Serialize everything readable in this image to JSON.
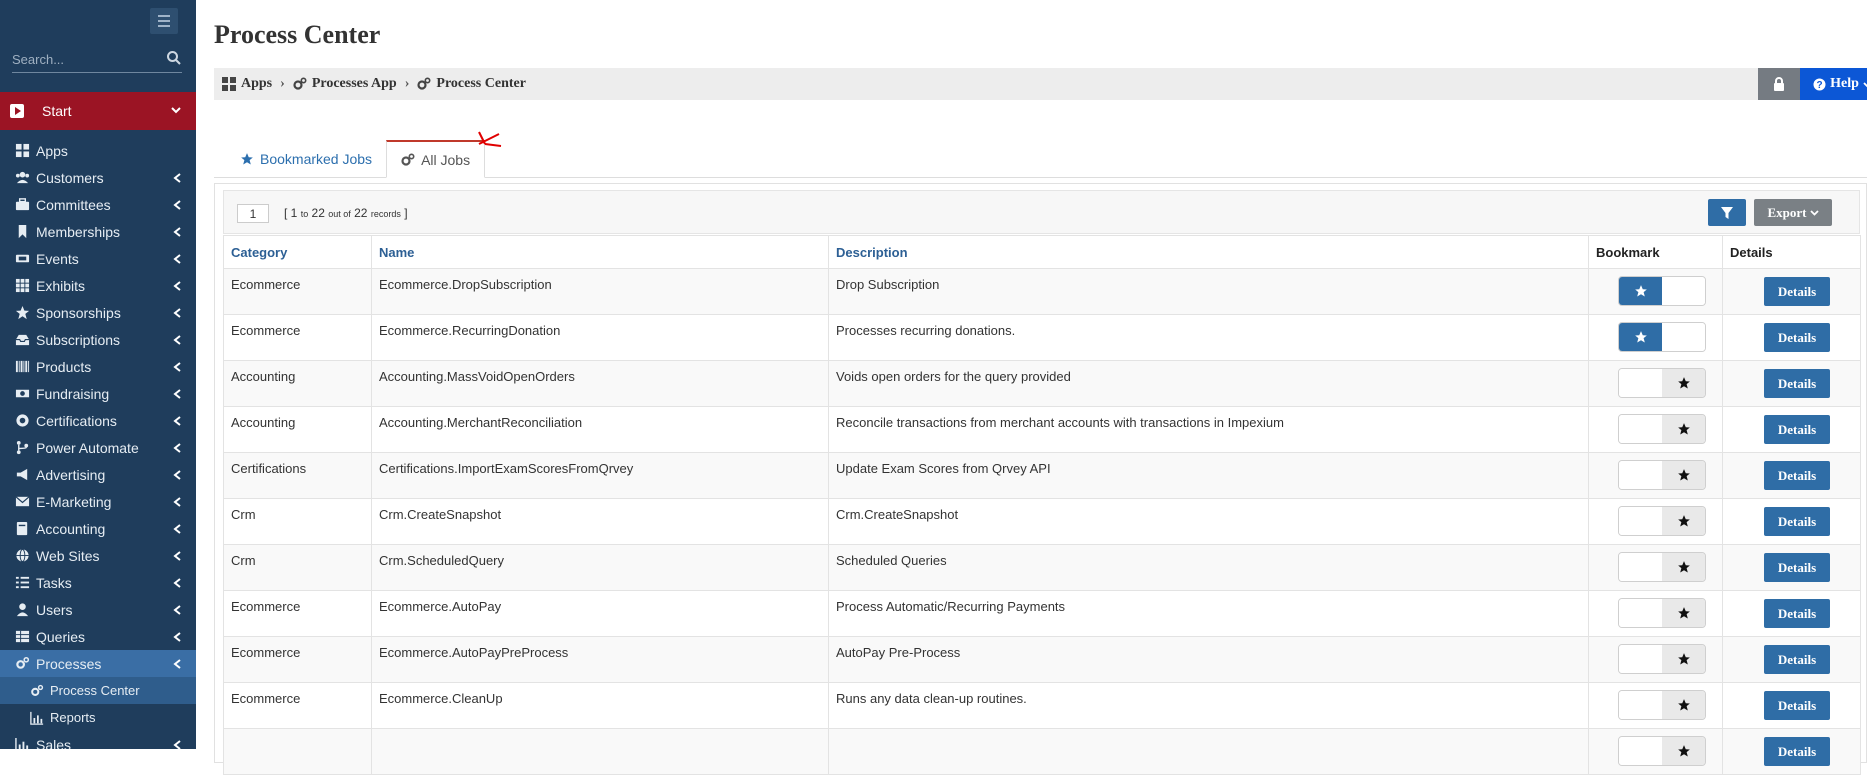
{
  "sidebar": {
    "search_placeholder": "Search...",
    "start_label": "Start",
    "items": [
      {
        "label": "Apps",
        "icon": "apps-icon",
        "has_chevron": false
      },
      {
        "label": "Customers",
        "icon": "users-icon",
        "has_chevron": true
      },
      {
        "label": "Committees",
        "icon": "briefcase-icon",
        "has_chevron": true
      },
      {
        "label": "Memberships",
        "icon": "bookmark-icon",
        "has_chevron": true
      },
      {
        "label": "Events",
        "icon": "ticket-icon",
        "has_chevron": true
      },
      {
        "label": "Exhibits",
        "icon": "grid-icon",
        "has_chevron": true
      },
      {
        "label": "Sponsorships",
        "icon": "star-icon",
        "has_chevron": true
      },
      {
        "label": "Subscriptions",
        "icon": "inbox-icon",
        "has_chevron": true
      },
      {
        "label": "Products",
        "icon": "barcode-icon",
        "has_chevron": true
      },
      {
        "label": "Fundraising",
        "icon": "money-icon",
        "has_chevron": true
      },
      {
        "label": "Certifications",
        "icon": "certificate-icon",
        "has_chevron": true
      },
      {
        "label": "Power Automate",
        "icon": "flow-icon",
        "has_chevron": true
      },
      {
        "label": "Advertising",
        "icon": "bullhorn-icon",
        "has_chevron": true
      },
      {
        "label": "E-Marketing",
        "icon": "envelope-icon",
        "has_chevron": true
      },
      {
        "label": "Accounting",
        "icon": "book-icon",
        "has_chevron": true
      },
      {
        "label": "Web Sites",
        "icon": "globe-icon",
        "has_chevron": true
      },
      {
        "label": "Tasks",
        "icon": "tasks-icon",
        "has_chevron": true
      },
      {
        "label": "Users",
        "icon": "user-icon",
        "has_chevron": true
      },
      {
        "label": "Queries",
        "icon": "table-icon",
        "has_chevron": true
      },
      {
        "label": "Processes",
        "icon": "cogs-icon",
        "has_chevron": true
      }
    ],
    "subitems": [
      {
        "label": "Process Center",
        "icon": "cogs-icon"
      },
      {
        "label": "Reports",
        "icon": "chart-icon"
      }
    ],
    "last_item": {
      "label": "Sales",
      "icon": "chart-icon"
    }
  },
  "page": {
    "title": "Process Center",
    "breadcrumbs": [
      "Apps",
      "Processes App",
      "Process Center"
    ],
    "help_label": "Help",
    "tabs": [
      {
        "label": "Bookmarked Jobs",
        "icon": "star-icon",
        "active": false
      },
      {
        "label": "All Jobs",
        "icon": "cogs-icon",
        "active": true
      }
    ]
  },
  "toolbar": {
    "page": "1",
    "records_open": "[ 1",
    "records_to": "to",
    "records_mid": "22",
    "records_outof": "out of",
    "records_total": "22",
    "records_word": "records",
    "records_close": "]",
    "export_label": "Export"
  },
  "table": {
    "headers": [
      "Category",
      "Name",
      "Description",
      "Bookmark",
      "Details"
    ],
    "details_label": "Details",
    "rows": [
      {
        "category": "Ecommerce",
        "name": "Ecommerce.DropSubscription",
        "description": "Drop Subscription",
        "bookmarked": true
      },
      {
        "category": "Ecommerce",
        "name": "Ecommerce.RecurringDonation",
        "description": "Processes recurring donations.",
        "bookmarked": true
      },
      {
        "category": "Accounting",
        "name": "Accounting.MassVoidOpenOrders",
        "description": "Voids open orders for the query provided",
        "bookmarked": false
      },
      {
        "category": "Accounting",
        "name": "Accounting.MerchantReconciliation",
        "description": "Reconcile transactions from merchant accounts with transactions in Impexium",
        "bookmarked": false
      },
      {
        "category": "Certifications",
        "name": "Certifications.ImportExamScoresFromQrvey",
        "description": "Update Exam Scores from Qrvey API",
        "bookmarked": false
      },
      {
        "category": "Crm",
        "name": "Crm.CreateSnapshot",
        "description": "Crm.CreateSnapshot",
        "bookmarked": false
      },
      {
        "category": "Crm",
        "name": "Crm.ScheduledQuery",
        "description": "Scheduled Queries",
        "bookmarked": false
      },
      {
        "category": "Ecommerce",
        "name": "Ecommerce.AutoPay",
        "description": "Process Automatic/Recurring Payments",
        "bookmarked": false
      },
      {
        "category": "Ecommerce",
        "name": "Ecommerce.AutoPayPreProcess",
        "description": "AutoPay Pre-Process",
        "bookmarked": false
      },
      {
        "category": "Ecommerce",
        "name": "Ecommerce.CleanUp",
        "description": "Runs any data clean-up routines.",
        "bookmarked": false
      },
      {
        "category": "",
        "name": "",
        "description": "",
        "bookmarked": false
      }
    ]
  },
  "colors": {
    "sidebar_bg": "#1f3d5c",
    "start_bg": "#9b1424",
    "active_bg": "#3a6ea5",
    "primary": "#2f6da6",
    "help": "#0c57d6",
    "annotation": "#e00000"
  }
}
